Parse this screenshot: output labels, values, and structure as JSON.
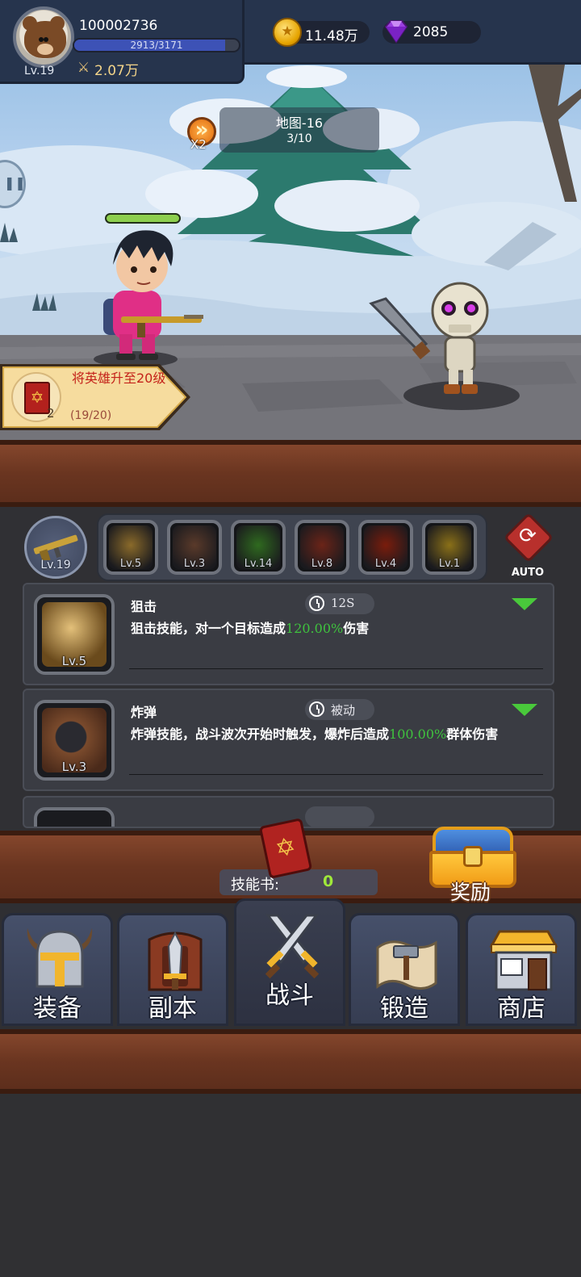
{
  "player": {
    "id": "100002736",
    "level": "Lv.19",
    "xp_text": "2913/3171",
    "xp_fraction": 0.918,
    "power": "2.07万",
    "avatar_icon": "bear-avatar-icon"
  },
  "resources": {
    "gold": "11.48万",
    "gems": "2085"
  },
  "battle": {
    "speed_label": "X2",
    "map_name": "地图-16",
    "wave_progress": "3/10",
    "hero_hp_fraction": 1.0
  },
  "quest": {
    "title": "将英雄升至20级",
    "progress": "(19/20)",
    "reward_count": "2"
  },
  "skills_bar": {
    "weapon_level": "Lv.19",
    "slots": [
      {
        "name": "sniper-skill-slot",
        "level": "Lv.5",
        "color": "#8a6a2a"
      },
      {
        "name": "bomb-skill-slot",
        "level": "Lv.3",
        "color": "#5a3a2a"
      },
      {
        "name": "poison-skill-slot",
        "level": "Lv.14",
        "color": "#2f6a1f"
      },
      {
        "name": "fireball-skill-slot",
        "level": "Lv.8",
        "color": "#6b2418"
      },
      {
        "name": "explosion-skill-slot",
        "level": "Lv.4",
        "color": "#7a1c0c"
      },
      {
        "name": "lightning-skill-slot",
        "level": "Lv.1",
        "color": "#8a7018"
      }
    ],
    "auto_label": "AUTO"
  },
  "skill_cards": [
    {
      "name": "狙击",
      "level": "Lv.5",
      "cooldown": "12S",
      "desc_before": "狙击技能，对一个目标造成",
      "desc_value": "120.00%",
      "desc_after": "伤害"
    },
    {
      "name": "炸弹",
      "level": "Lv.3",
      "cooldown": "被动",
      "desc_before": "炸弹技能，战斗波次开始时触发，爆炸后造成",
      "desc_value": "100.00%",
      "desc_after": "群体伤害"
    }
  ],
  "skill_book": {
    "label": "技能书:",
    "count": "0"
  },
  "reward": {
    "label": "奖励"
  },
  "nav": [
    {
      "label": "装备",
      "icon": "equipment-helmet-icon"
    },
    {
      "label": "副本",
      "icon": "dungeon-sword-icon"
    },
    {
      "label": "战斗",
      "icon": "battle-crossed-swords-icon"
    },
    {
      "label": "锻造",
      "icon": "forge-scroll-icon"
    },
    {
      "label": "商店",
      "icon": "shop-store-icon"
    }
  ]
}
